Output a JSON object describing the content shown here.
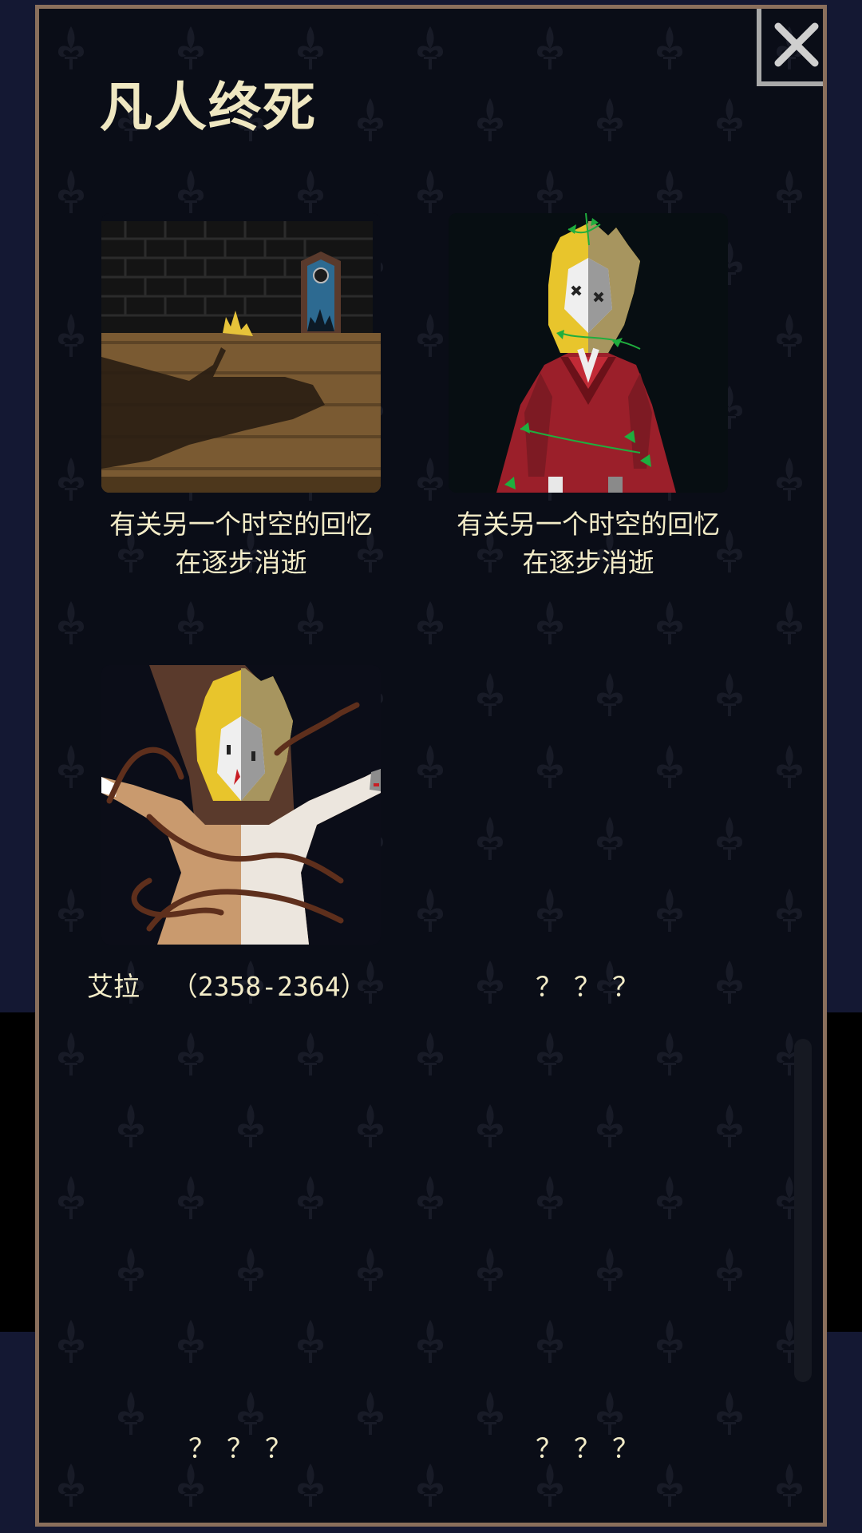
{
  "panel": {
    "title": "凡人终死",
    "close_icon": "close-x-icon"
  },
  "cards": [
    {
      "image": "castle-room-shadow-crown",
      "caption_line1": "有关另一个时空的回忆",
      "caption_line2": "在逐步消逝"
    },
    {
      "image": "queen-red-dress-vines",
      "caption_line1": "有关另一个时空的回忆",
      "caption_line2": "在逐步消逝"
    },
    {
      "image": "queen-white-dress-roots",
      "name": "艾拉",
      "years": "（2358-2364）"
    },
    {
      "placeholder": "？？？"
    },
    {
      "placeholder": "？？？"
    },
    {
      "placeholder": "？？？"
    }
  ],
  "colors": {
    "accent_text": "#f3ecc8",
    "border": "#8a6f5c",
    "panel_bg": "#0a0d17"
  }
}
